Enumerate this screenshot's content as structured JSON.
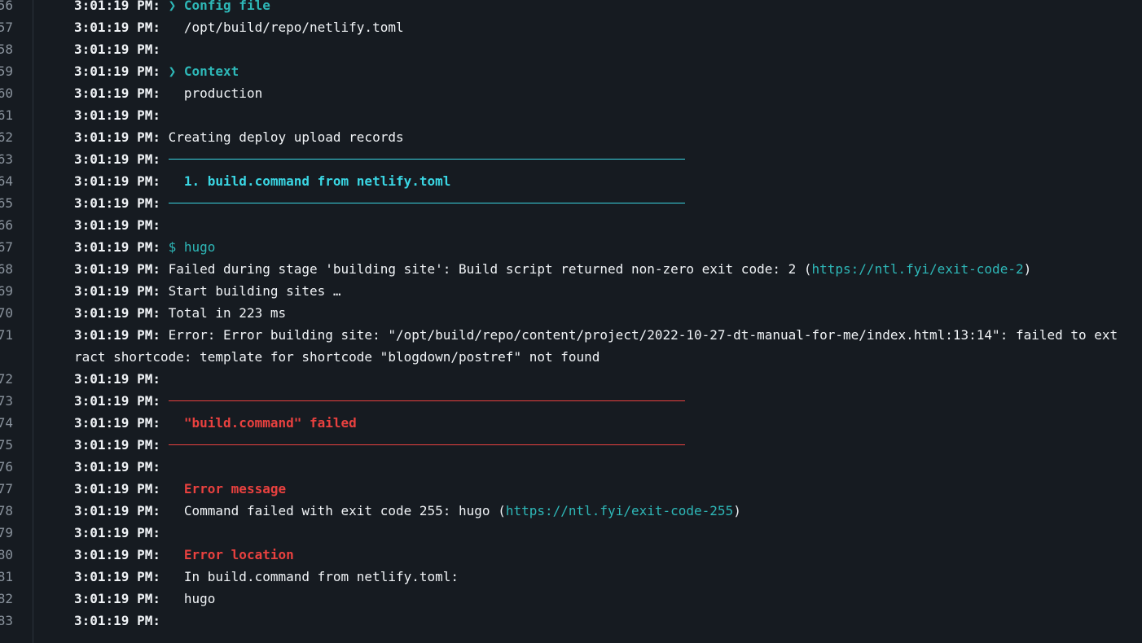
{
  "timestamp": "3:01:19 PM:",
  "lines": [
    {
      "n": "56",
      "prefix": " ",
      "main": "❯ Config file",
      "style": "cyan"
    },
    {
      "n": "57",
      "prefix": "   ",
      "main": "/opt/build/repo/netlify.toml",
      "style": "plain"
    },
    {
      "n": "58",
      "prefix": "",
      "main": "",
      "style": "plain"
    },
    {
      "n": "59",
      "prefix": " ",
      "main": "❯ Context",
      "style": "cyan"
    },
    {
      "n": "60",
      "prefix": "   ",
      "main": "production",
      "style": "plain"
    },
    {
      "n": "61",
      "prefix": "",
      "main": "",
      "style": "plain"
    },
    {
      "n": "62",
      "prefix": " ",
      "main": "Creating deploy upload records",
      "style": "plain"
    },
    {
      "n": "63",
      "prefix": " ",
      "main": "",
      "style": "rule-cyan"
    },
    {
      "n": "64",
      "prefix": "   ",
      "main": "1. build.command from netlify.toml",
      "style": "bright-cyan"
    },
    {
      "n": "65",
      "prefix": " ",
      "main": "",
      "style": "rule-cyan"
    },
    {
      "n": "66",
      "prefix": "",
      "main": "",
      "style": "plain"
    },
    {
      "n": "67",
      "prefix": " ",
      "main": "$ hugo",
      "style": "cyan-norm"
    },
    {
      "n": "68",
      "prefix": " ",
      "main": "Failed during stage 'building site': Build script returned non-zero exit code: 2 (",
      "link": "https://ntl.fyi/exit-code-2",
      "after": ")",
      "style": "plain"
    },
    {
      "n": "69",
      "prefix": " ",
      "main": "Start building sites …",
      "style": "plain"
    },
    {
      "n": "70",
      "prefix": " ",
      "main": "Total in 223 ms",
      "style": "plain"
    },
    {
      "n": "71",
      "prefix": " ",
      "main": "Error: Error building site: \"/opt/build/repo/content/project/2022-10-27-dt-manual-for-me/index.html:13:14\": failed to extract shortcode: template for shortcode \"blogdown/postref\" not found",
      "style": "plain"
    },
    {
      "n": "72",
      "prefix": "",
      "main": "",
      "style": "plain"
    },
    {
      "n": "73",
      "prefix": " ",
      "main": "",
      "style": "rule-red"
    },
    {
      "n": "74",
      "prefix": "   ",
      "main": "\"build.command\" failed",
      "style": "red"
    },
    {
      "n": "75",
      "prefix": " ",
      "main": "",
      "style": "rule-red"
    },
    {
      "n": "76",
      "prefix": "",
      "main": "",
      "style": "plain"
    },
    {
      "n": "77",
      "prefix": "   ",
      "main": "Error message",
      "style": "red"
    },
    {
      "n": "78",
      "prefix": "   ",
      "main": "Command failed with exit code 255: hugo (",
      "link": "https://ntl.fyi/exit-code-255",
      "after": ")",
      "style": "plain"
    },
    {
      "n": "79",
      "prefix": "",
      "main": "",
      "style": "plain"
    },
    {
      "n": "80",
      "prefix": "   ",
      "main": "Error location",
      "style": "red"
    },
    {
      "n": "81",
      "prefix": "   ",
      "main": "In build.command from netlify.toml:",
      "style": "plain"
    },
    {
      "n": "82",
      "prefix": "   ",
      "main": "hugo",
      "style": "plain"
    },
    {
      "n": "83",
      "prefix": "",
      "main": "",
      "style": "plain"
    }
  ]
}
